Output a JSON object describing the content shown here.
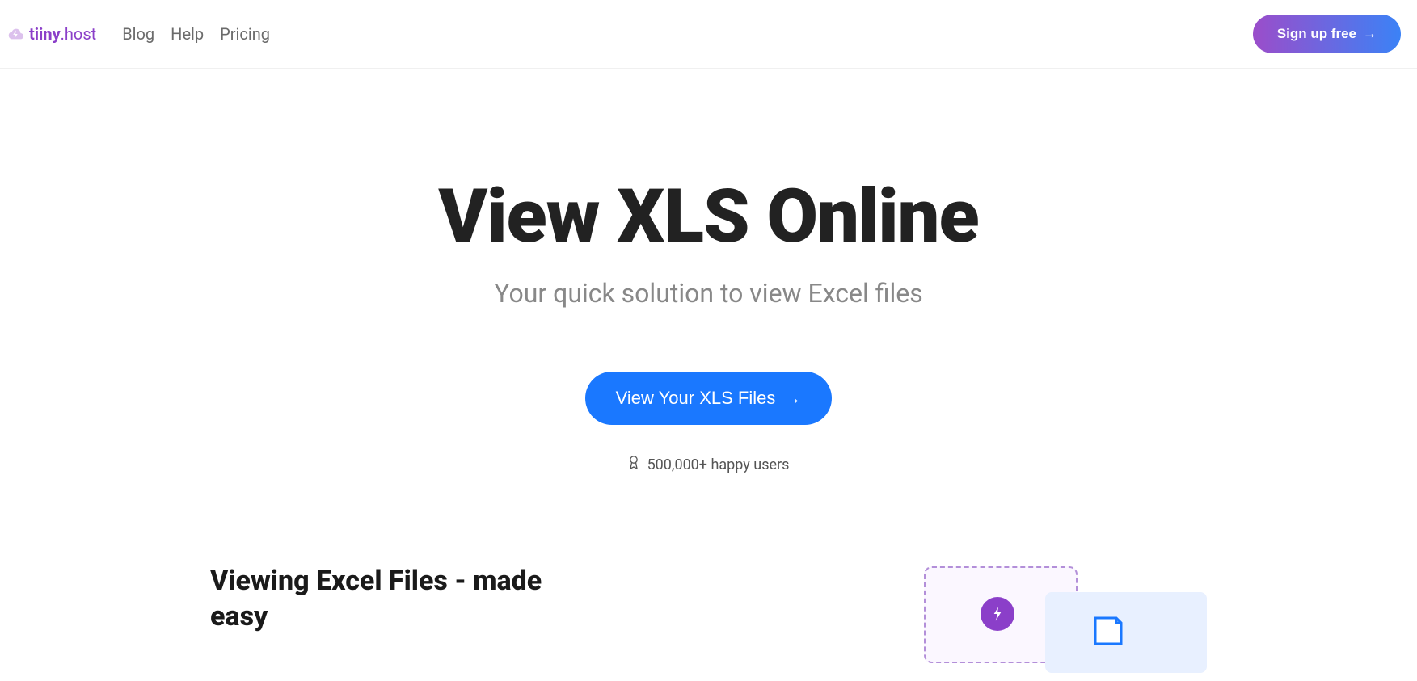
{
  "header": {
    "logo_name": "tiiny",
    "logo_domain": ".host",
    "nav": {
      "blog": "Blog",
      "help": "Help",
      "pricing": "Pricing"
    },
    "signup_label": "Sign up free",
    "signup_arrow": "→"
  },
  "hero": {
    "title": "View XLS Online",
    "subtitle": "Your quick solution to view Excel files",
    "cta_label": "View Your XLS Files",
    "cta_arrow": "→",
    "users_text": "500,000+ happy users"
  },
  "section": {
    "title": "Viewing Excel Files - made easy"
  }
}
